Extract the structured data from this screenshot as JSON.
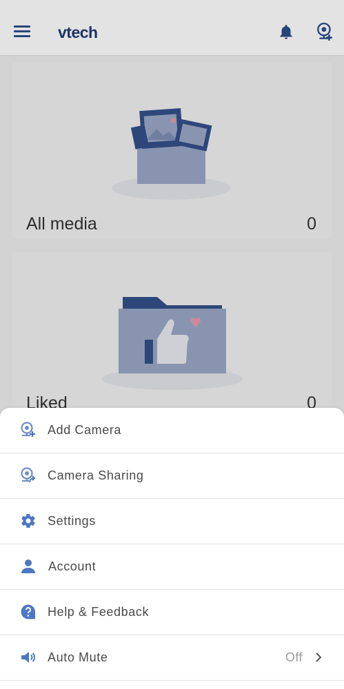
{
  "header": {
    "logo": "vtech",
    "icons": {
      "menu": "hamburger-icon",
      "notifications": "bell-icon",
      "add_camera": "add-camera-icon"
    }
  },
  "cards": [
    {
      "title": "All media",
      "count": "0",
      "icon": "media-box-illustration"
    },
    {
      "title": "Liked",
      "count": "0",
      "icon": "liked-folder-illustration"
    }
  ],
  "menu": {
    "items": [
      {
        "label": "Add Camera",
        "icon": "add-camera-icon"
      },
      {
        "label": "Camera Sharing",
        "icon": "camera-share-icon"
      },
      {
        "label": "Settings",
        "icon": "gear-icon"
      },
      {
        "label": "Account",
        "icon": "person-icon"
      },
      {
        "label": "Help & Feedback",
        "icon": "help-icon"
      },
      {
        "label": "Auto Mute",
        "icon": "speaker-icon",
        "value": "Off"
      }
    ]
  },
  "colors": {
    "brand": "#1f3b70",
    "accent": "#4d78c2",
    "icon_blue": "#6e8fcb",
    "heart": "#f0a0b8"
  }
}
